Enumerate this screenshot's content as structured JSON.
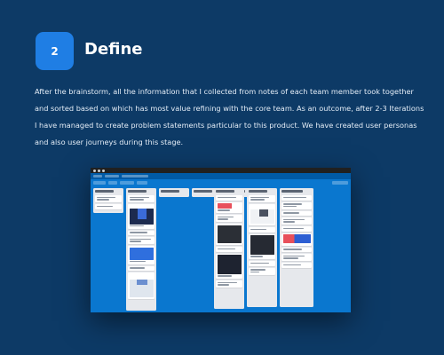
{
  "section": {
    "step_number": "2",
    "title": "Define",
    "body": "After the brainstorm, all the information that I collected from notes of each team member took together and sorted based on which has most value refining with the core team.  As an outcome, after 2-3 Iterations I have managed to create problem statements particular to this product.  We have created user personas and also user journeys during this stage."
  },
  "screenshot": {
    "lists": [
      {
        "cards": [
          "text",
          "text"
        ]
      },
      {
        "cards": [
          "text",
          "phone-image",
          "text",
          "text",
          "wide-image",
          "text",
          "map-image"
        ]
      },
      {
        "cards": []
      },
      {
        "cards": []
      },
      {
        "cards": []
      },
      {
        "cards": [
          "text",
          "tag",
          "text",
          "photo",
          "text",
          "photo",
          "text"
        ]
      },
      {
        "cards": [
          "text",
          "photo",
          "text",
          "photo",
          "text",
          "text"
        ]
      },
      {
        "cards": [
          "text",
          "text",
          "text",
          "text",
          "text",
          "color-block",
          "text",
          "text",
          "text"
        ]
      }
    ],
    "colors": {
      "board_bg": "#0a77cf",
      "list_bg": "#e6e8ec",
      "page_bg": "#0d3a66",
      "badge": "#1f7ee4"
    }
  }
}
